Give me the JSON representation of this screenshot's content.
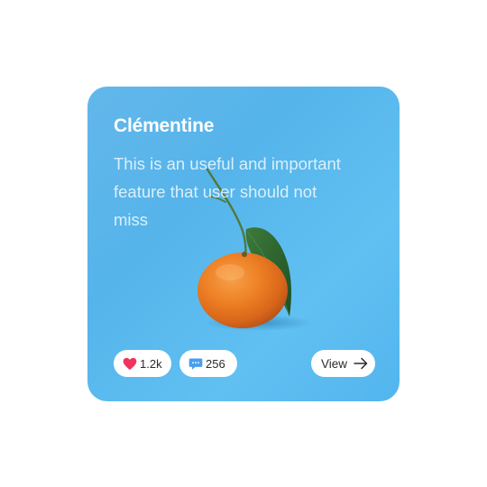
{
  "card": {
    "title": "Clémentine",
    "description": "This is an useful and important feature that user should not miss",
    "likes": {
      "count": "1.2k",
      "icon": "heart-icon",
      "color": "#f0335c"
    },
    "comments": {
      "count": "256",
      "icon": "chat-bubble-icon",
      "color": "#4a9ef0"
    },
    "view_button": {
      "label": "View",
      "icon": "arrow-right-icon"
    },
    "background_color": "#58b6ec"
  }
}
